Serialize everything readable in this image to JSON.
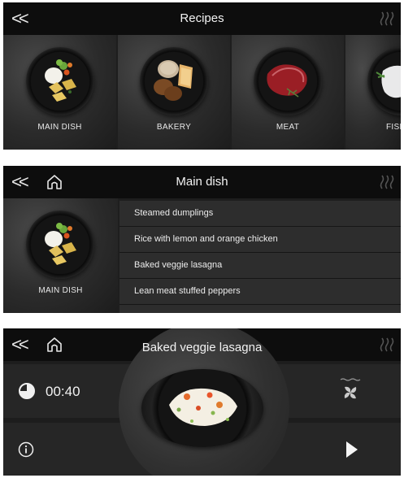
{
  "screen1": {
    "title": "Recipes",
    "categories": [
      {
        "label": "MAIN DISH"
      },
      {
        "label": "BAKERY"
      },
      {
        "label": "MEAT"
      },
      {
        "label": "FISH"
      }
    ]
  },
  "screen2": {
    "title": "Main dish",
    "category_label": "MAIN DISH",
    "recipes": [
      "Steamed dumplings",
      "Rice with lemon and orange chicken",
      "Baked veggie lasagna",
      "Lean meat stuffed peppers"
    ]
  },
  "screen3": {
    "title": "Baked veggie lasagna",
    "time": "00:40"
  },
  "colors": {
    "topbar": "#0d0d0d",
    "panel": "#262626",
    "list_row": "#2d2d2d",
    "accent_food": "#e8a23a"
  },
  "icons": [
    "back-icon",
    "home-icon",
    "heating-icon",
    "timer-icon",
    "fan-icon",
    "info-icon",
    "play-icon"
  ]
}
